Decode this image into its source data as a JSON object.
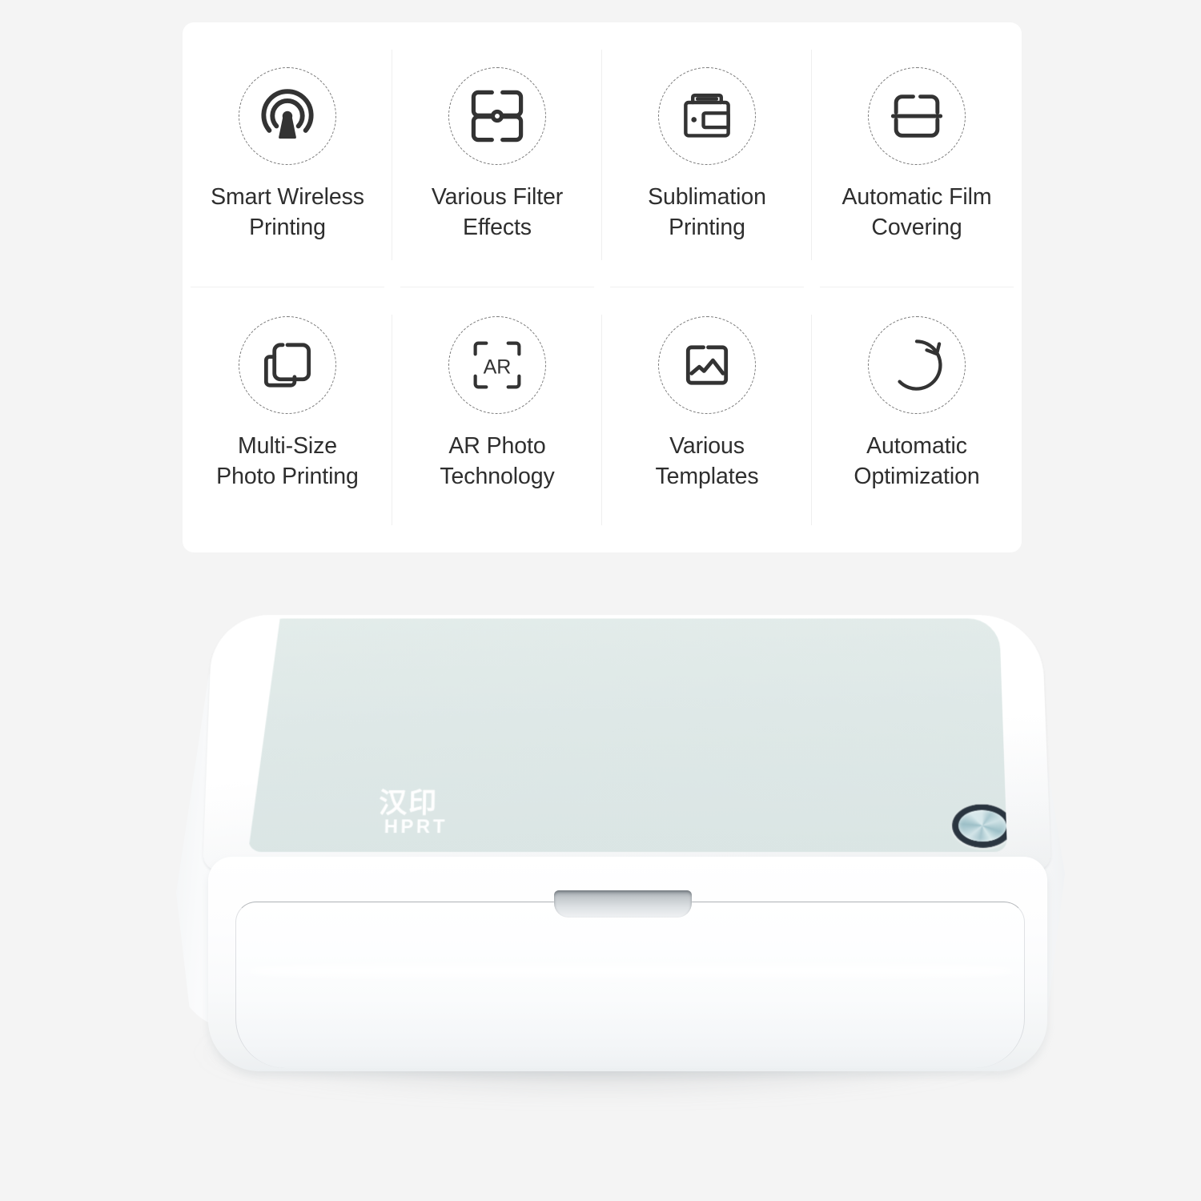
{
  "page": {
    "background_color": "#f4f4f4"
  },
  "feature_card": {
    "background_color": "#ffffff",
    "divider_color": "#efefef",
    "label_color": "#2e2e2e",
    "icon_stroke_color": "#333333",
    "features": [
      {
        "icon": "wireless-broadcast-icon",
        "label": "Smart Wireless\nPrinting"
      },
      {
        "icon": "filter-petals-icon",
        "label": "Various Filter\nEffects"
      },
      {
        "icon": "printer-icon",
        "label": "Sublimation\nPrinting"
      },
      {
        "icon": "film-laminate-icon",
        "label": "Automatic Film\nCovering"
      },
      {
        "icon": "stacked-squares-icon",
        "label": "Multi-Size\nPhoto Printing"
      },
      {
        "icon": "ar-scan-icon",
        "label": "AR Photo\nTechnology"
      },
      {
        "icon": "image-template-icon",
        "label": "Various\nTemplates"
      },
      {
        "icon": "refresh-circle-icon",
        "label": "Automatic\nOptimization"
      }
    ]
  },
  "product": {
    "name": "photo-printer",
    "body_color": "#ffffff",
    "top_plate_color": "#dee8e7",
    "brand_logo_cn": "汉印",
    "brand_logo_en": "HPRT",
    "power_button_label": "power-button",
    "ar_icon_text": "AR"
  }
}
